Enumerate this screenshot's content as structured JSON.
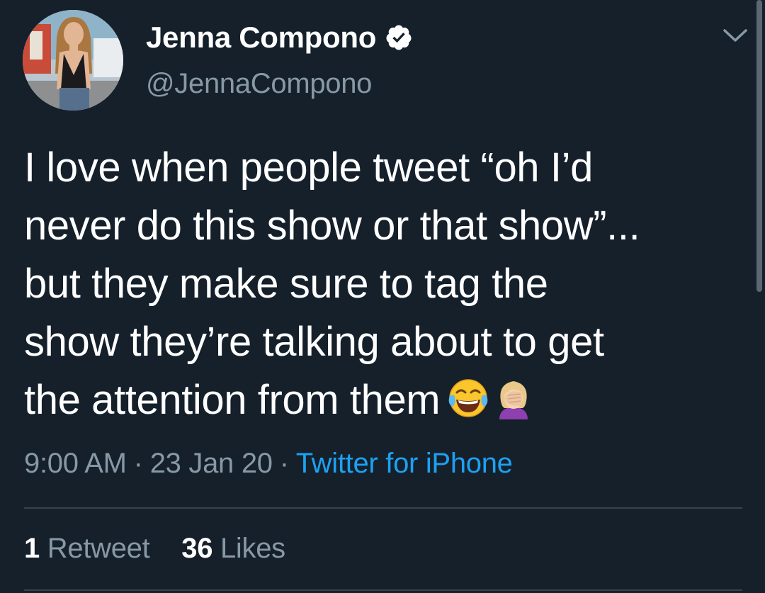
{
  "author": {
    "display_name": "Jenna Compono",
    "handle": "@JennaCompono",
    "verified": true,
    "avatar": "avatar-photo"
  },
  "tweet": {
    "lines": [
      "I love when people tweet “oh I’d",
      "never do this show or that show”...",
      "but they make sure to tag the",
      "show they’re talking about to get",
      "the attention from them"
    ],
    "emojis": [
      "face-with-tears-of-joy-icon",
      "person-facepalming-icon"
    ]
  },
  "meta": {
    "time": "9:00 AM",
    "separator": "·",
    "date": "23 Jan 20",
    "source": "Twitter for iPhone"
  },
  "stats": {
    "retweets_count": "1",
    "retweets_label": "Retweet",
    "likes_count": "36",
    "likes_label": "Likes"
  },
  "colors": {
    "background": "#15202b",
    "text": "#ffffff",
    "secondary": "#8899a6",
    "link": "#1da1f2",
    "divider": "#38444d",
    "verified": "#ffffff"
  }
}
